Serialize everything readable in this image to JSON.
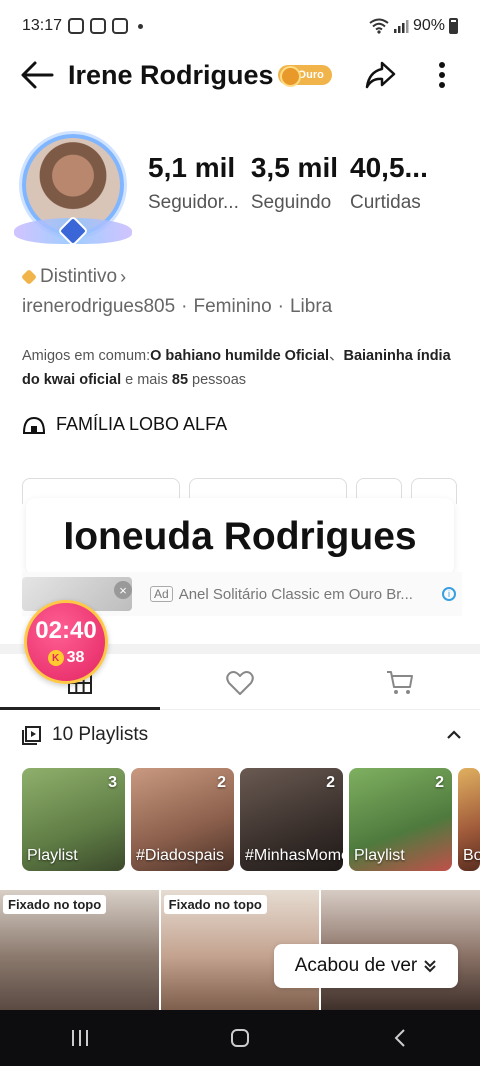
{
  "status_bar": {
    "time": "13:17",
    "battery": "90%",
    "icons": [
      "instagram-icon",
      "instagram-icon",
      "gallery-icon",
      "wifi-icon",
      "signal-icon",
      "battery-icon"
    ]
  },
  "header": {
    "name": "Irene Rodrigues",
    "badge": "Ouro",
    "icons": [
      "back-arrow-icon",
      "share-icon",
      "more-vertical-icon"
    ]
  },
  "stats": [
    {
      "value": "5,1 mil",
      "label": "Seguidor..."
    },
    {
      "value": "3,5 mil",
      "label": "Seguindo"
    },
    {
      "value": "40,5...",
      "label": "Curtidas"
    }
  ],
  "profile": {
    "distintivo": "Distintivo",
    "chevron": "›",
    "username": "irenerodrigues805",
    "separator": "·",
    "gender": "Feminino",
    "sign": "Libra"
  },
  "friends": {
    "prefix": "Amigos em comum:",
    "friend1": "O bahiano humilde Oficial",
    "separator": "、",
    "friend2": "Baianinha índia do kwai oficial",
    "middle": " e mais ",
    "count": "85",
    "suffix": " pessoas"
  },
  "family": {
    "label": "FAMÍLIA LOBO ALFA"
  },
  "overlay": {
    "text": "Ioneuda Rodrigues"
  },
  "ad": {
    "tag": "Ad",
    "text": "Anel Solitário Classic em Ouro Br...",
    "close": "×",
    "info": "i"
  },
  "timer": {
    "time": "02:40",
    "coin_symbol": "K",
    "coins": "38"
  },
  "tabs": [
    {
      "name": "videos-grid",
      "icon": "grid-icon",
      "active": true
    },
    {
      "name": "liked",
      "icon": "heart-icon",
      "active": false
    },
    {
      "name": "shop",
      "icon": "cart-icon",
      "active": false
    }
  ],
  "playlists": {
    "title": "10 Playlists",
    "items": [
      {
        "count": "3",
        "label": "Playlist",
        "color": "#7a9c5d"
      },
      {
        "count": "2",
        "label": "#Diadospais",
        "color": "#9a6b5a"
      },
      {
        "count": "2",
        "label": "#MinhasMomentoDia",
        "color": "#4b3f3a"
      },
      {
        "count": "2",
        "label": "Playlist",
        "color": "#5d8a4a"
      },
      {
        "count": "",
        "label": "Bo",
        "color": "#a05a3a"
      }
    ]
  },
  "videos": [
    {
      "pinned": "Fixado no topo",
      "color": "#8c7a6e"
    },
    {
      "pinned": "Fixado no topo",
      "color": "#b89c8a"
    },
    {
      "pinned": "",
      "color": "#6f5b52"
    }
  ],
  "finished_label": "Acabou de ver",
  "colors": {
    "accent": "#e32562",
    "gold": "#f0b44a",
    "navbar": "#0d0d0f"
  }
}
